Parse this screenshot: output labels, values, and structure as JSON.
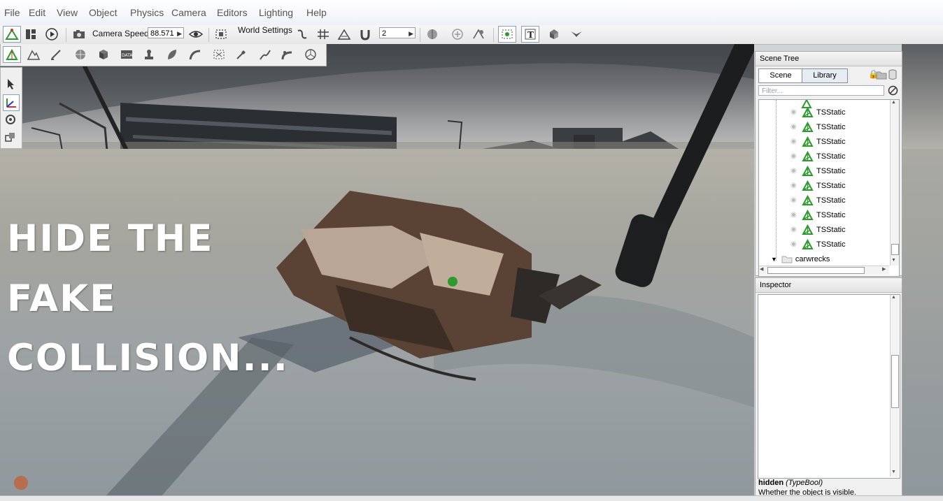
{
  "menu": [
    "File",
    "Edit",
    "View",
    "Object",
    "Physics",
    "Camera",
    "Editors",
    "Lighting",
    "Help"
  ],
  "toolbar": {
    "camera_speed_label": "Camera Speed",
    "camera_speed_value": "88.571",
    "world_settings_label": "World Settings",
    "snap_value": "2"
  },
  "viewport": {
    "overlay_lines": [
      "HIDE THE",
      "FAKE",
      "COLLISION..."
    ]
  },
  "scene_tree": {
    "title": "Scene Tree",
    "tabs": [
      "Scene",
      "Library"
    ],
    "active_tab": "Scene",
    "filter_placeholder": "Filter...",
    "items": [
      "TSStatic",
      "TSStatic",
      "TSStatic",
      "TSStatic",
      "TSStatic",
      "TSStatic",
      "TSStatic",
      "TSStatic",
      "TSStatic",
      "TSStatic"
    ],
    "folder": "carwrecks"
  },
  "inspector": {
    "title": "Inspector",
    "field_name": "hidden",
    "field_type": "(TypeBool)",
    "field_desc": "Whether the object is visible."
  },
  "colors": {
    "accent_green": "#2e9a2e",
    "overlay_text": "#ffffff",
    "tab_active": "#ffffff",
    "tab_inactive": "#e6ecf4"
  }
}
